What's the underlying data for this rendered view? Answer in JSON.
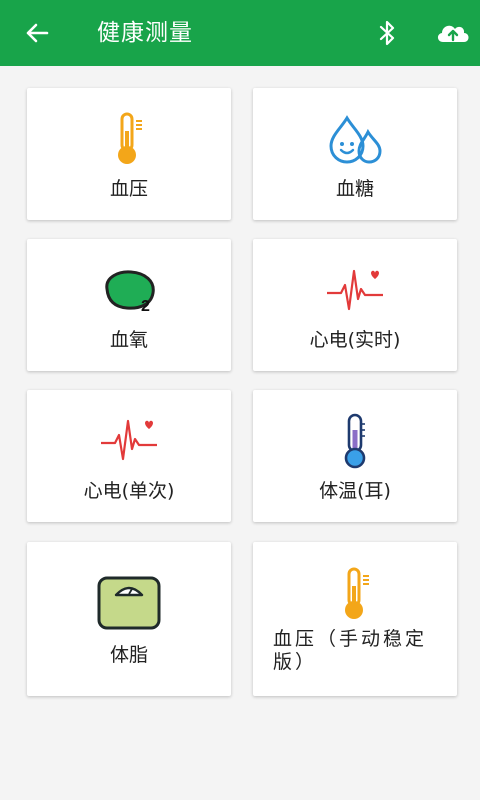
{
  "header": {
    "title": "健康测量",
    "back_icon": "arrow-left-icon",
    "bluetooth_icon": "bluetooth-icon",
    "upload_icon": "cloud-upload-icon",
    "bg_color": "#18a44a"
  },
  "cards": [
    {
      "label": "血压",
      "icon": "thermometer-icon"
    },
    {
      "label": "血糖",
      "icon": "water-drop-icon"
    },
    {
      "label": "血氧",
      "icon": "oxygen-blob-icon"
    },
    {
      "label": "心电(实时)",
      "icon": "ecg-heart-icon"
    },
    {
      "label": "心电(单次)",
      "icon": "ecg-heart-icon"
    },
    {
      "label": "体温(耳)",
      "icon": "thermometer-icon"
    },
    {
      "label": "体脂",
      "icon": "body-scale-icon"
    },
    {
      "label": "血压（手动稳定版）",
      "icon": "thermometer-icon"
    }
  ],
  "colors": {
    "accent_orange": "#f3a619",
    "drop_blue": "#2c8fd6",
    "oxygen_green": "#1fad55",
    "ecg_red": "#e23a3a",
    "scale_green": "#c5d98a"
  }
}
